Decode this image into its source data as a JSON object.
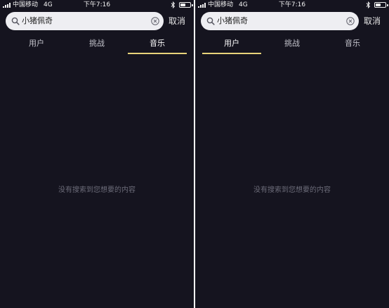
{
  "status_bar": {
    "carrier": "中国移动",
    "network": "4G",
    "time": "下午7:16"
  },
  "search": {
    "value": "小猪佩奇",
    "cancel_label": "取消"
  },
  "tabs": [
    {
      "label": "用户"
    },
    {
      "label": "挑战"
    },
    {
      "label": "音乐"
    }
  ],
  "empty_message": "没有搜索到您想要的内容",
  "colors": {
    "background": "#15141f",
    "search_box": "#eeeef2",
    "tab_indicator": "#e8d37a",
    "muted_text": "#6b6b78"
  },
  "screens": [
    {
      "active_tab": "音乐"
    },
    {
      "active_tab": "用户"
    }
  ]
}
